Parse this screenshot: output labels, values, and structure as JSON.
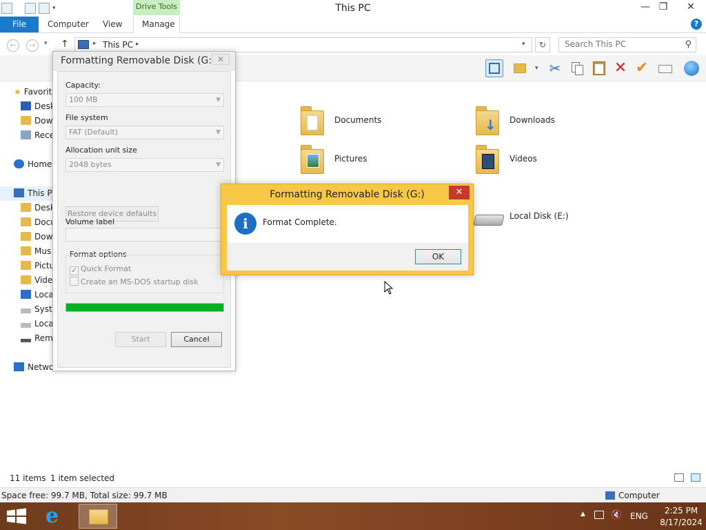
{
  "window": {
    "title": "This PC",
    "context_tab": "Drive Tools",
    "controls": {
      "minimize": "—",
      "maximize": "❐",
      "close": "✕"
    }
  },
  "ribbon_tabs": {
    "file": "File",
    "computer": "Computer",
    "view": "View",
    "manage": "Manage",
    "help": "?"
  },
  "address": {
    "path": "This PC",
    "search_placeholder": "Search This PC"
  },
  "nav_pane": {
    "items": [
      "Favorit",
      "Desk",
      "Dow",
      "Rece",
      "Home",
      "This P",
      "Desk",
      "Docu",
      "Dow",
      "Mus",
      "Pictu",
      "Vide",
      "Loca",
      "Syste",
      "Loca",
      "Rem",
      "Netwo"
    ]
  },
  "content": {
    "folders": [
      "Documents",
      "Downloads",
      "Pictures",
      "Videos"
    ],
    "drive": "Local Disk (E:)"
  },
  "status_bar": {
    "items_count": "11 items",
    "selected": "1 item selected",
    "space": "Space free: 99.7 MB, Total size: 99.7 MB",
    "location": "Computer"
  },
  "format_dialog": {
    "title": "Formatting Removable Disk (G:)",
    "close": "✕",
    "capacity_label": "Capacity:",
    "capacity_value": "100 MB",
    "fs_label": "File system",
    "fs_value": "FAT (Default)",
    "alloc_label": "Allocation unit size",
    "alloc_value": "2048 bytes",
    "restore_btn": "Restore device defaults",
    "volume_label": "Volume label",
    "options_label": "Format options",
    "quick_format": "Quick Format",
    "msdos": "Create an MS-DOS startup disk",
    "progress": 1.0,
    "start_btn": "Start",
    "cancel_btn": "Cancel"
  },
  "complete_dialog": {
    "title": "Formatting Removable Disk (G:)",
    "close": "✕",
    "message": "Format Complete.",
    "ok": "OK"
  },
  "taskbar": {
    "language": "ENG",
    "time": "2:25 PM",
    "date": "8/17/2024"
  },
  "colors": {
    "accent": "#1979ca",
    "dialog_frame": "#f7c746",
    "progress": "#06b025"
  }
}
